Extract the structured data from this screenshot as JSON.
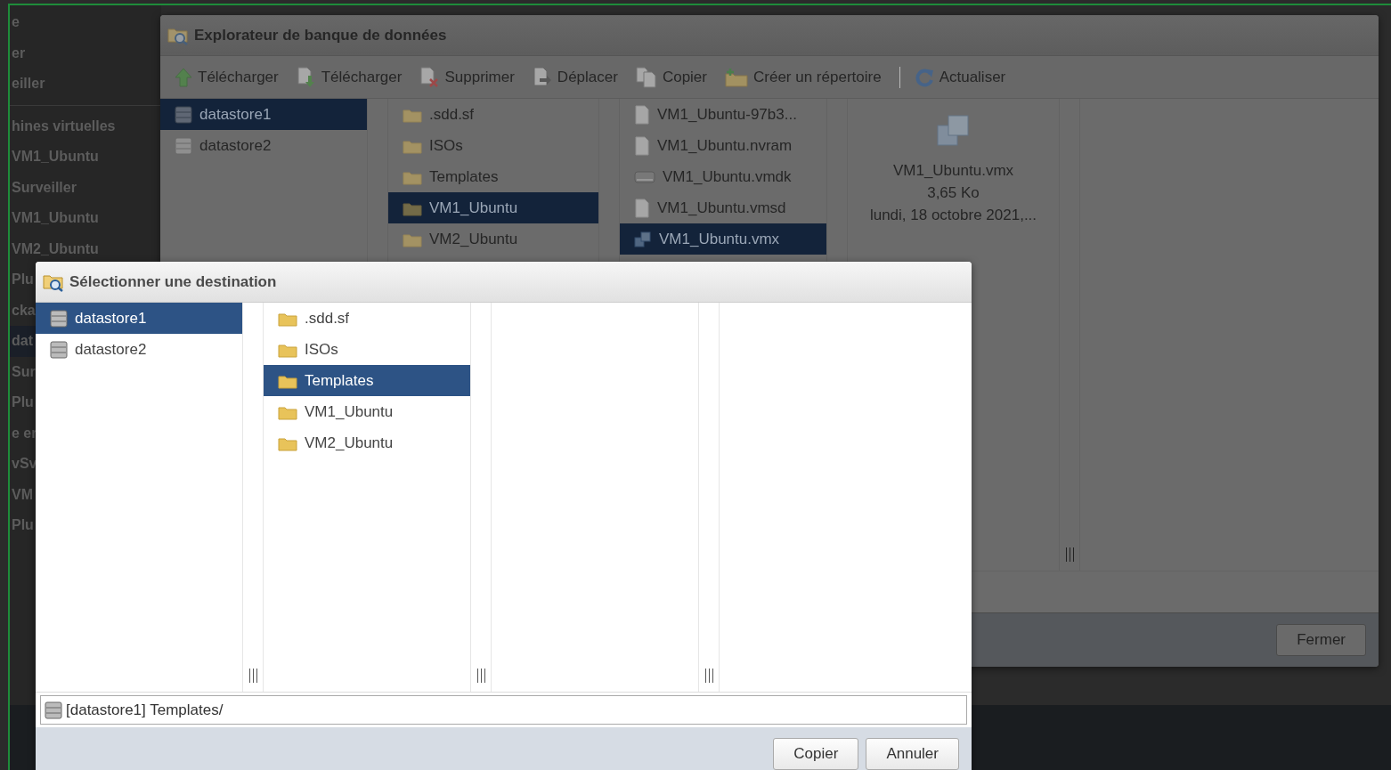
{
  "background_sidebar": {
    "items": [
      {
        "label": "e",
        "selected": false
      },
      {
        "label": "er",
        "selected": false
      },
      {
        "label": "eiller",
        "selected": false
      },
      {
        "label": "hines virtuelles",
        "selected": false
      },
      {
        "label": "VM1_Ubuntu",
        "selected": false
      },
      {
        "label": "Surveiller",
        "selected": false
      },
      {
        "label": "VM1_Ubuntu",
        "selected": false
      },
      {
        "label": "VM2_Ubuntu",
        "selected": false
      },
      {
        "label": "Plu",
        "selected": false
      },
      {
        "label": "cka",
        "selected": false
      },
      {
        "label": "dat",
        "selected": true
      },
      {
        "label": "Sur",
        "selected": false
      },
      {
        "label": "Plu",
        "selected": false
      },
      {
        "label": "e er",
        "selected": false
      },
      {
        "label": "vSv",
        "selected": false
      },
      {
        "label": "VM",
        "selected": false
      },
      {
        "label": "Plu",
        "selected": false
      }
    ]
  },
  "explorer": {
    "title": "Explorateur de banque de données",
    "toolbar": [
      {
        "kind": "upload",
        "label": "Télécharger"
      },
      {
        "kind": "download",
        "label": "Télécharger"
      },
      {
        "kind": "delete",
        "label": "Supprimer"
      },
      {
        "kind": "move",
        "label": "Déplacer"
      },
      {
        "kind": "copy",
        "label": "Copier"
      },
      {
        "kind": "new-folder",
        "label": "Créer un répertoire"
      },
      {
        "kind": "separator"
      },
      {
        "kind": "refresh",
        "label": "Actualiser"
      }
    ],
    "datastores": [
      {
        "label": "datastore1",
        "selected": true
      },
      {
        "label": "datastore2",
        "selected": false
      }
    ],
    "folders": [
      {
        "label": ".sdd.sf",
        "selected": false
      },
      {
        "label": "ISOs",
        "selected": false
      },
      {
        "label": "Templates",
        "selected": false
      },
      {
        "label": "VM1_Ubuntu",
        "selected": true
      },
      {
        "label": "VM2_Ubuntu",
        "selected": false
      }
    ],
    "files": [
      {
        "kind": "file",
        "label": "VM1_Ubuntu-97b3...",
        "selected": false
      },
      {
        "kind": "file",
        "label": "VM1_Ubuntu.nvram",
        "selected": false
      },
      {
        "kind": "disk",
        "label": "VM1_Ubuntu.vmdk",
        "selected": false
      },
      {
        "kind": "file",
        "label": "VM1_Ubuntu.vmsd",
        "selected": false
      },
      {
        "kind": "vm",
        "label": "VM1_Ubuntu.vmx",
        "selected": true
      }
    ],
    "preview": {
      "name": "VM1_Ubuntu.vmx",
      "size": "3,65 Ko",
      "date": "lundi, 18 octobre 2021,..."
    },
    "buttons": [
      "Fermer"
    ]
  },
  "dialog": {
    "title": "Sélectionner une destination",
    "datastores": [
      {
        "label": "datastore1",
        "selected": true
      },
      {
        "label": "datastore2",
        "selected": false
      }
    ],
    "folders": [
      {
        "label": ".sdd.sf",
        "selected": false
      },
      {
        "label": "ISOs",
        "selected": false
      },
      {
        "label": "Templates",
        "selected": true
      },
      {
        "label": "VM1_Ubuntu",
        "selected": false
      },
      {
        "label": "VM2_Ubuntu",
        "selected": false
      }
    ],
    "path": "[datastore1] Templates/",
    "buttons": [
      "Copier",
      "Annuler"
    ]
  }
}
